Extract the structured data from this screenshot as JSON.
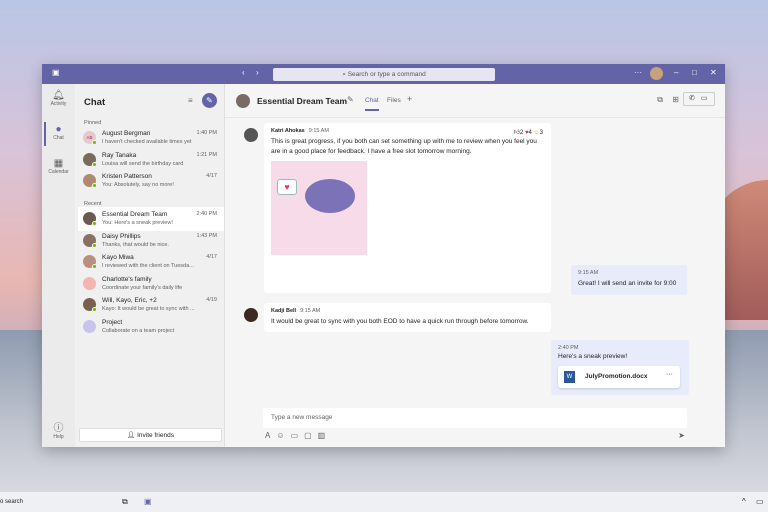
{
  "window": {
    "search_placeholder": "Search or type a command"
  },
  "rail": [
    {
      "label": "Activity",
      "icon": "bell-icon"
    },
    {
      "label": "Chat",
      "icon": "chat-icon"
    },
    {
      "label": "Calendar",
      "icon": "calendar-icon"
    },
    {
      "label": "Help",
      "icon": "help-icon"
    }
  ],
  "chat_list": {
    "title": "Chat",
    "pinned_label": "Pinned",
    "recent_label": "Recent",
    "invite_label": "Invite friends",
    "pinned": [
      {
        "name": "August Bergman",
        "preview": "I haven't checked available times yet",
        "time": "1:40 PM",
        "initials": "AB"
      },
      {
        "name": "Ray Tanaka",
        "preview": "Louisa will send the birthday card",
        "time": "1:21 PM"
      },
      {
        "name": "Kristen Patterson",
        "preview": "You: Absolutely, say no more!",
        "time": "4/17"
      }
    ],
    "recent": [
      {
        "name": "Essential Dream Team",
        "preview": "You: Here's a sneak preview!",
        "time": "2:40 PM"
      },
      {
        "name": "Daisy Phillips",
        "preview": "Thanks, that would be nice.",
        "time": "1:43 PM"
      },
      {
        "name": "Kayo Miwa",
        "preview": "I reviewed with the client on Tuesda...",
        "time": "4/17"
      },
      {
        "name": "Charlotte's family",
        "preview": "Coordinate your family's daily life",
        "time": ""
      },
      {
        "name": "Will, Kayo, Eric, +2",
        "preview": "Kayo: It would be great to sync with ...",
        "time": "4/19"
      },
      {
        "name": "Project",
        "preview": "Collaborate on a team project",
        "time": ""
      }
    ]
  },
  "conversation": {
    "title": "Essential Dream Team",
    "tabs": [
      "Chat",
      "Files"
    ],
    "messages": [
      {
        "sender": "Katri Ahokas",
        "time": "9:15 AM",
        "text": "This is great progress, if you both can set something up with me to review when you feel you are in a good place for feedback. I have a free slot tomorrow morning.",
        "reactions": [
          {
            "icon": "thumbs-up",
            "count": "2"
          },
          {
            "icon": "heart",
            "count": "4"
          },
          {
            "icon": "laugh",
            "count": "3"
          }
        ]
      },
      {
        "sender": "",
        "time": "9:15 AM",
        "text": "Great! I will send an invite for 9:00"
      },
      {
        "sender": "Kadji Bell",
        "time": "9:15 AM",
        "text": "It would be great to sync with you both EOD to have a quick run through before tomorrow."
      },
      {
        "sender": "",
        "time": "2:40 PM",
        "text": "Here's a sneak preview!",
        "file": "JulyPromotion.docx"
      }
    ],
    "compose_placeholder": "Type a new message"
  },
  "taskbar": {
    "search": "o search"
  },
  "colors": {
    "accent": "#6264a7"
  }
}
